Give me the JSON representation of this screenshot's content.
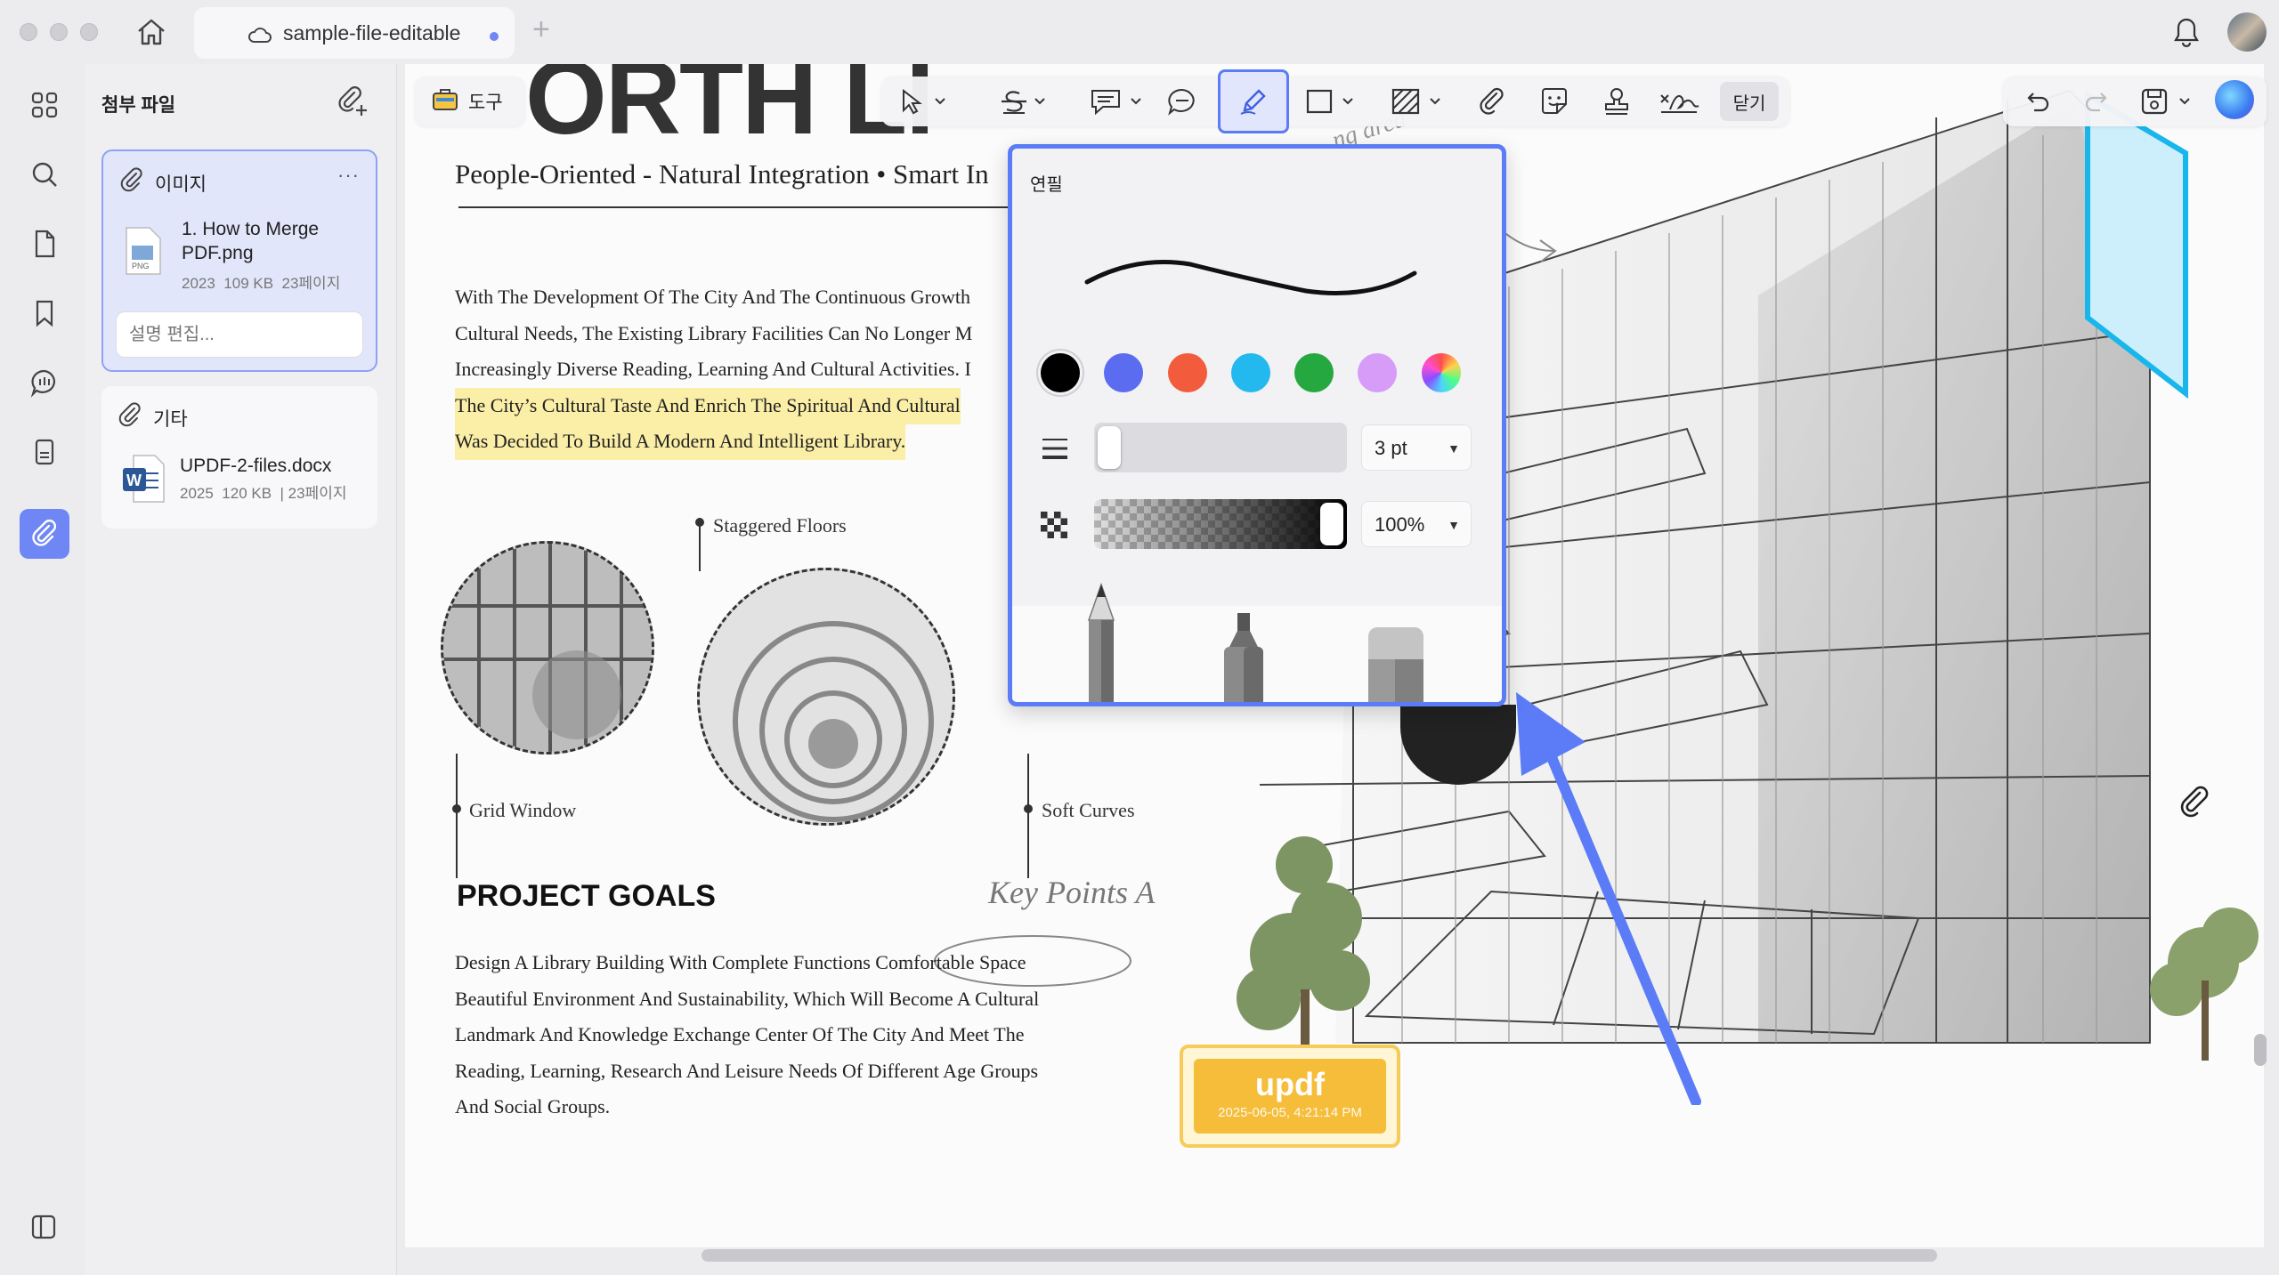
{
  "window": {
    "tab_title": "sample-file-editable"
  },
  "panel": {
    "title": "첨부 파일",
    "groups": [
      {
        "label": "이미지",
        "file_name": "1. How to Merge PDF.png",
        "year": "2023",
        "size": "109 KB",
        "pages": "23페이지",
        "description_placeholder": "설명 편집..."
      },
      {
        "label": "기타",
        "file_name": "UPDF-2-files.docx",
        "year": "2025",
        "size": "120 KB",
        "pages": "23페이지"
      }
    ]
  },
  "toolbar": {
    "tools_label": "도구",
    "close_label": "닫기"
  },
  "pencil_popup": {
    "title": "연필",
    "colors": [
      "#000000",
      "#5b6cf0",
      "#f25c3c",
      "#23b8ee",
      "#26a840",
      "#d69cf7",
      "rainbow"
    ],
    "selected_color": "#000000",
    "stroke_width": "3 pt",
    "opacity": "100%",
    "opacity_value": 1.0
  },
  "document": {
    "title": "ORTH LI",
    "subtitle": "People-Oriented - Natural Integration • Smart In",
    "intro_lines": [
      "With The Development Of The City And The Continuous Growth",
      "Cultural Needs, The Existing Library Facilities Can No Longer M",
      "Increasingly Diverse Reading, Learning And Cultural Activities. I",
      "The City’s Cultural Taste And Enrich The Spiritual And Cultural",
      "Was Decided To Build A Modern And Intelligent Library."
    ],
    "labels": {
      "staggered": "Staggered Floors",
      "grid": "Grid Window",
      "soft": "Soft Curves"
    },
    "goals_heading": "PROJECT GOALS",
    "key_points": "Key Points A",
    "goals_lines": [
      "Design A Library Building With Complete Functions Comfortable Space",
      "Beautiful Environment And Sustainability, Which Will Become A Cultural",
      "Landmark And Knowledge Exchange Center Of The City And Meet The",
      "Reading, Learning, Research And Leisure Needs Of Different Age Groups",
      "And Social Groups."
    ],
    "stamp": {
      "title": "updf",
      "date": "2025-06-05, 4:21:14 PM"
    }
  }
}
